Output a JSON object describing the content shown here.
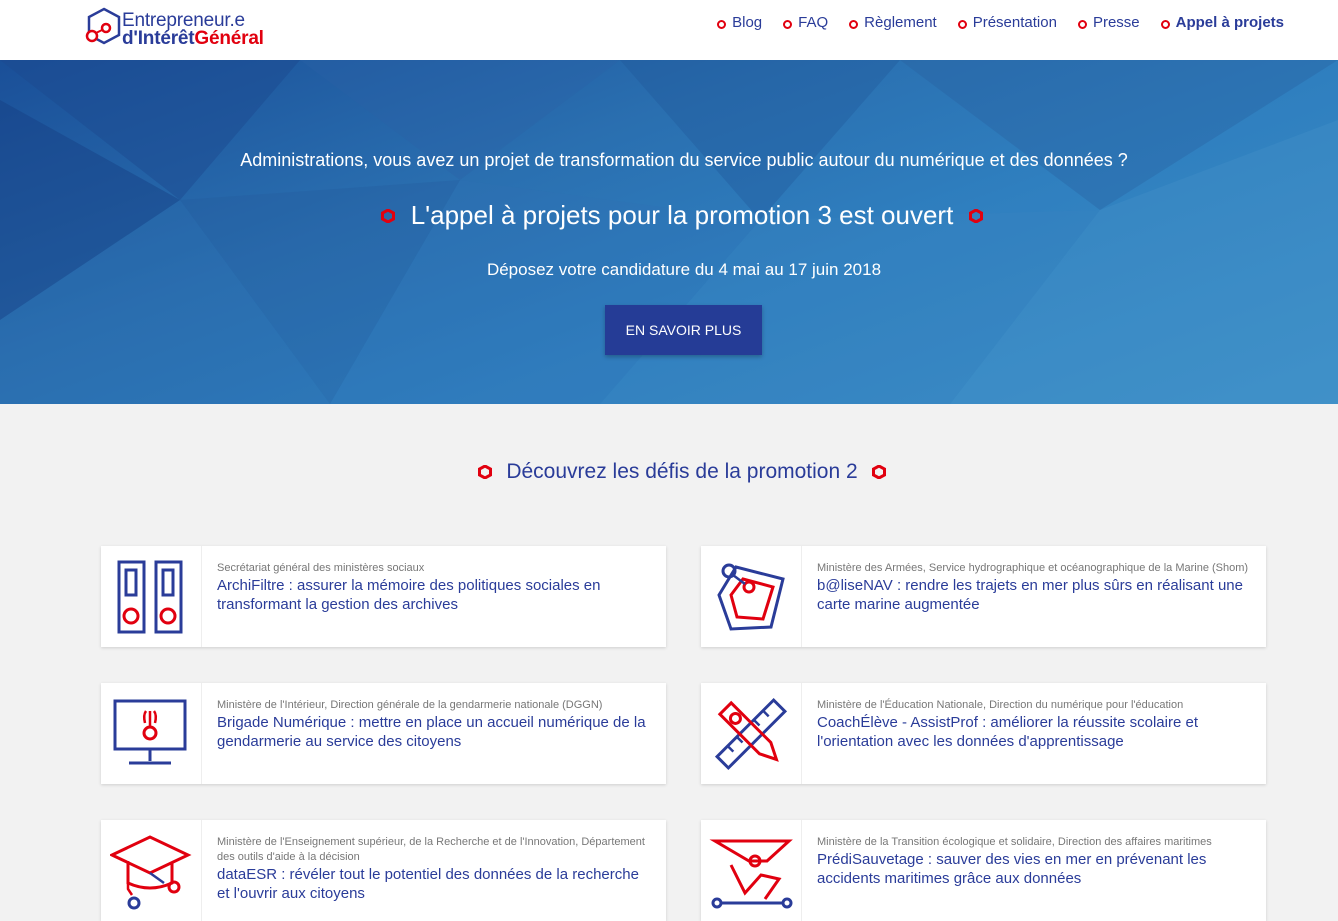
{
  "header": {
    "logo_line1": "Entrepreneur.e",
    "logo_line2_part1": "d'Intérêt",
    "logo_line2_part2": "Général",
    "nav": [
      {
        "label": "Blog"
      },
      {
        "label": "FAQ"
      },
      {
        "label": "Règlement"
      },
      {
        "label": "Présentation"
      },
      {
        "label": "Presse"
      },
      {
        "label": "Appel à projets"
      }
    ]
  },
  "hero": {
    "question": "Administrations, vous avez un projet de transformation du service public autour du numérique et des données ?",
    "title": "L'appel à projets pour la promotion 3 est ouvert",
    "dates": "Déposez votre candidature du 4 mai au 17 juin 2018",
    "button": "EN SAVOIR PLUS"
  },
  "section": {
    "title": "Découvrez les défis de la promotion 2"
  },
  "cards": [
    {
      "icon": "folders-icon",
      "org": "Secrétariat général des ministères sociaux",
      "title": "ArchiFiltre : assurer la mémoire des politiques sociales en transformant la gestion des archives"
    },
    {
      "icon": "tag-icon",
      "org": "Ministère des Armées, Service hydrographique et océanographique de la Marine (Shom)",
      "title": "b@liseNAV : rendre les trajets en mer plus sûrs en réalisant une carte marine augmentée"
    },
    {
      "icon": "monitor-icon",
      "org": "Ministère de l'Intérieur, Direction générale de la gendarmerie nationale (DGGN)",
      "title": "Brigade Numérique : mettre en place un accueil numérique de la gendarmerie au service des citoyens"
    },
    {
      "icon": "pen-ruler-icon",
      "org": "Ministère de l'Éducation Nationale, Direction du numérique pour l'éducation",
      "title": "CoachÉlève - AssistProf : améliorer la réussite scolaire et l'orientation avec les données d'apprentissage"
    },
    {
      "icon": "graduation-cap-icon",
      "org": "Ministère de l'Enseignement supérieur, de la Recherche et de l'Innovation, Département des outils d'aide à la décision",
      "title": "dataESR : révéler tout le potentiel des données de la recherche et l'ouvrir aux citoyens"
    },
    {
      "icon": "boat-icon",
      "org": "Ministère de la Transition écologique et solidaire, Direction des affaires maritimes",
      "title": "PrédiSauvetage : sauver des vies en mer en prévenant les accidents maritimes grâce aux données"
    }
  ],
  "colors": {
    "accent_red": "#e1000f",
    "brand_blue": "#2a3c99",
    "button_blue": "#253c96"
  }
}
